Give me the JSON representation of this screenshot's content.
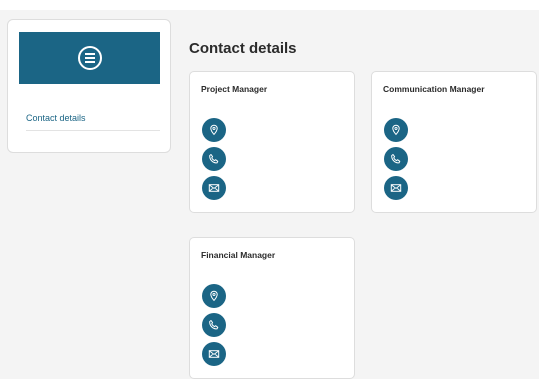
{
  "sidebar": {
    "menu_icon": "menu-icon",
    "items": [
      {
        "label": "Contact details"
      }
    ]
  },
  "main": {
    "title": "Contact details",
    "cards": [
      {
        "title": "Project Manager",
        "icons": [
          "location-pin-icon",
          "phone-icon",
          "mail-icon"
        ]
      },
      {
        "title": "Communication Manager",
        "icons": [
          "location-pin-icon",
          "phone-icon",
          "mail-icon"
        ]
      },
      {
        "title": "Financial Manager",
        "icons": [
          "location-pin-icon",
          "phone-icon",
          "mail-icon"
        ]
      }
    ]
  },
  "colors": {
    "brand": "#1b6585",
    "background": "#f4f4f4",
    "card": "#ffffff"
  }
}
